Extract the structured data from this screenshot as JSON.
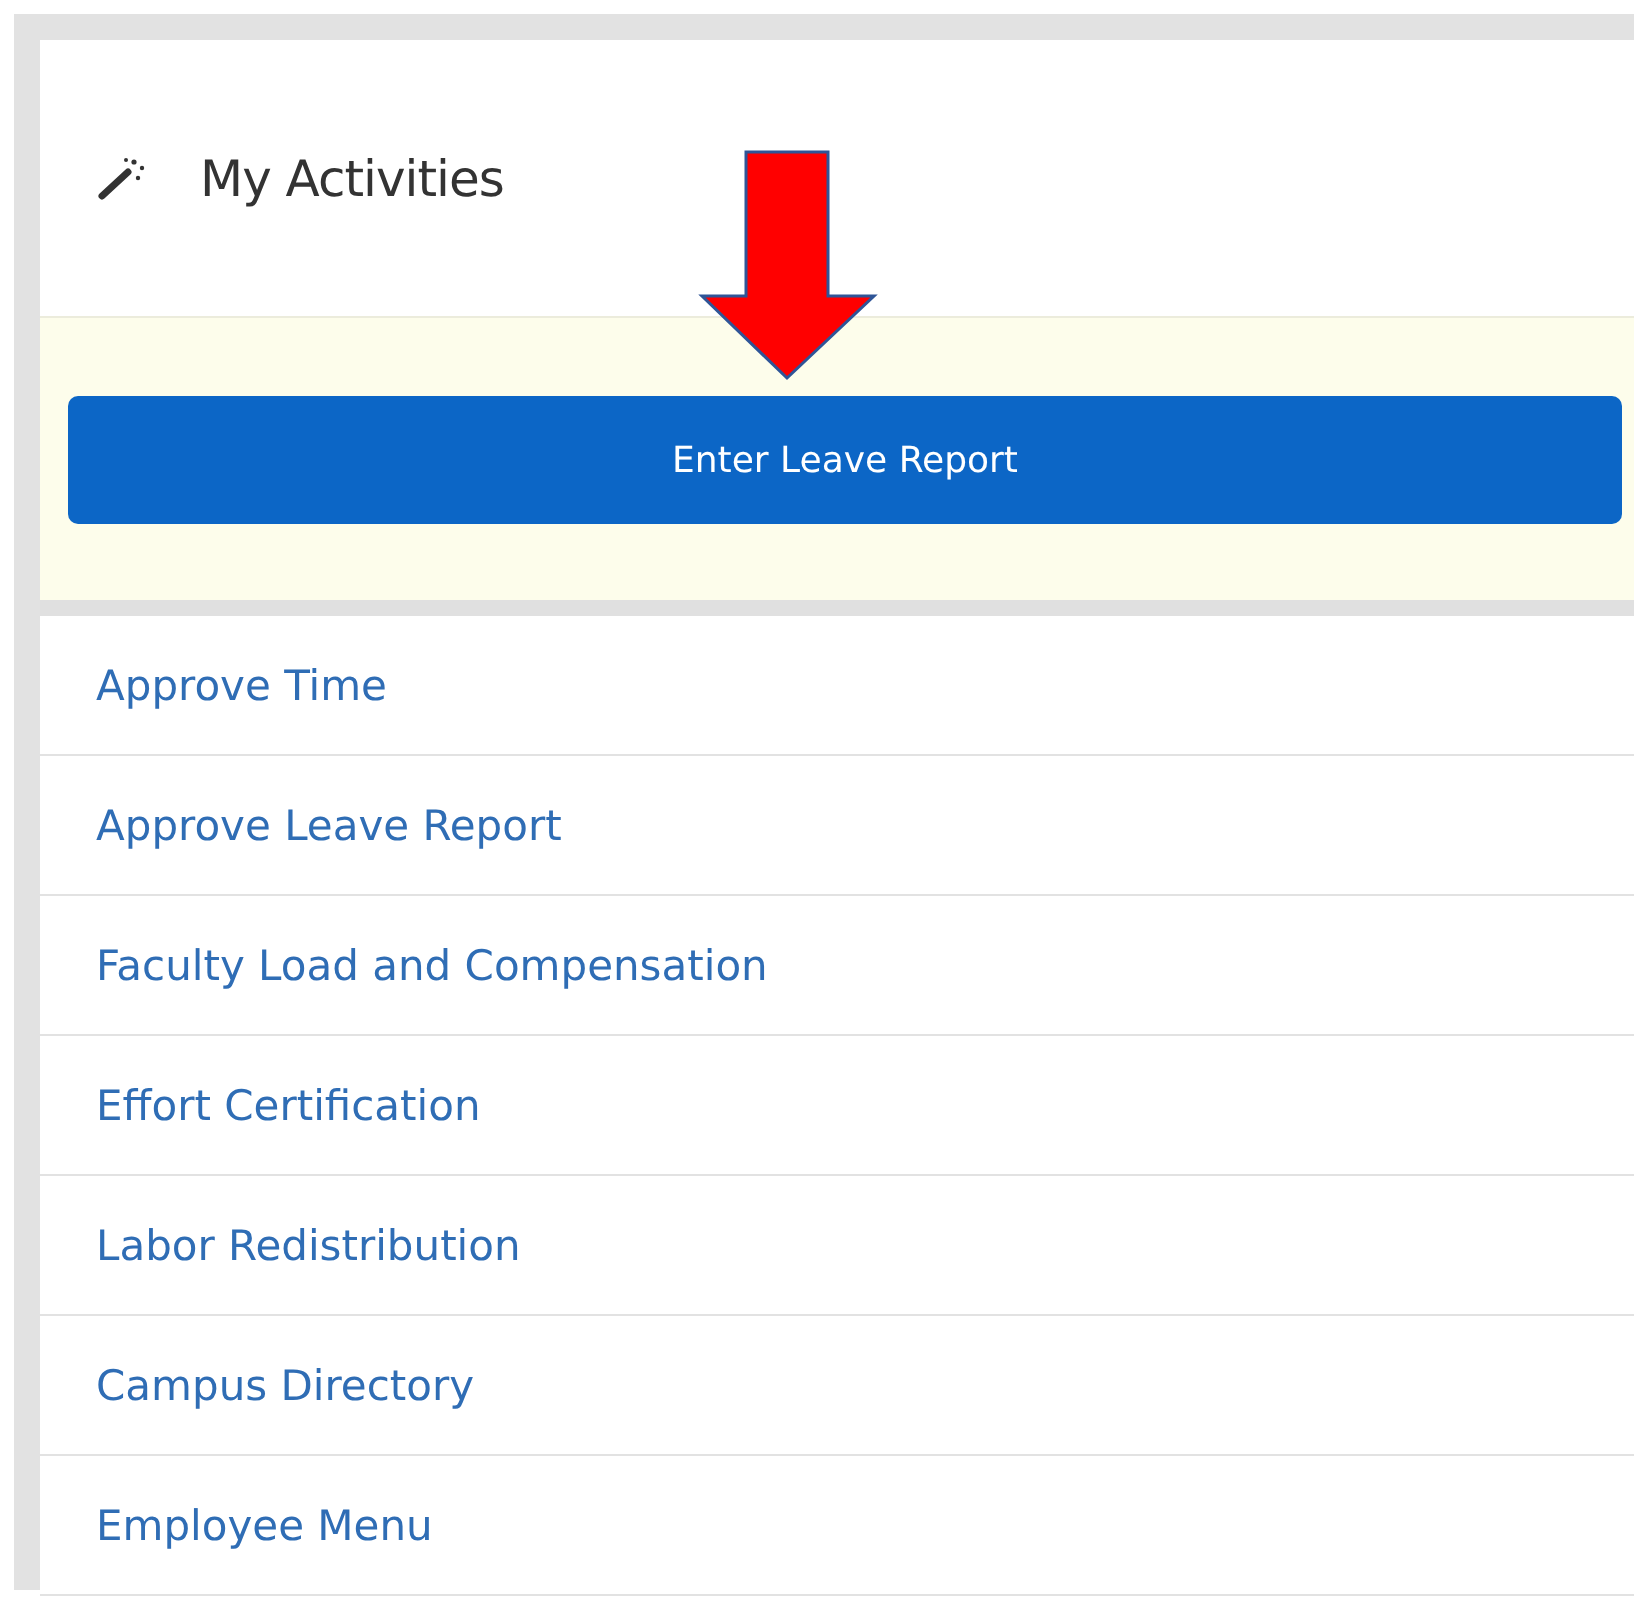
{
  "panel": {
    "title": "My Activities"
  },
  "primary_action": {
    "label": "Enter Leave Report"
  },
  "activities": [
    {
      "label": "Approve Time"
    },
    {
      "label": "Approve Leave Report"
    },
    {
      "label": "Faculty Load and Compensation"
    },
    {
      "label": "Effort Certification"
    },
    {
      "label": "Labor Redistribution"
    },
    {
      "label": "Campus Directory"
    },
    {
      "label": "Employee Menu"
    }
  ]
}
